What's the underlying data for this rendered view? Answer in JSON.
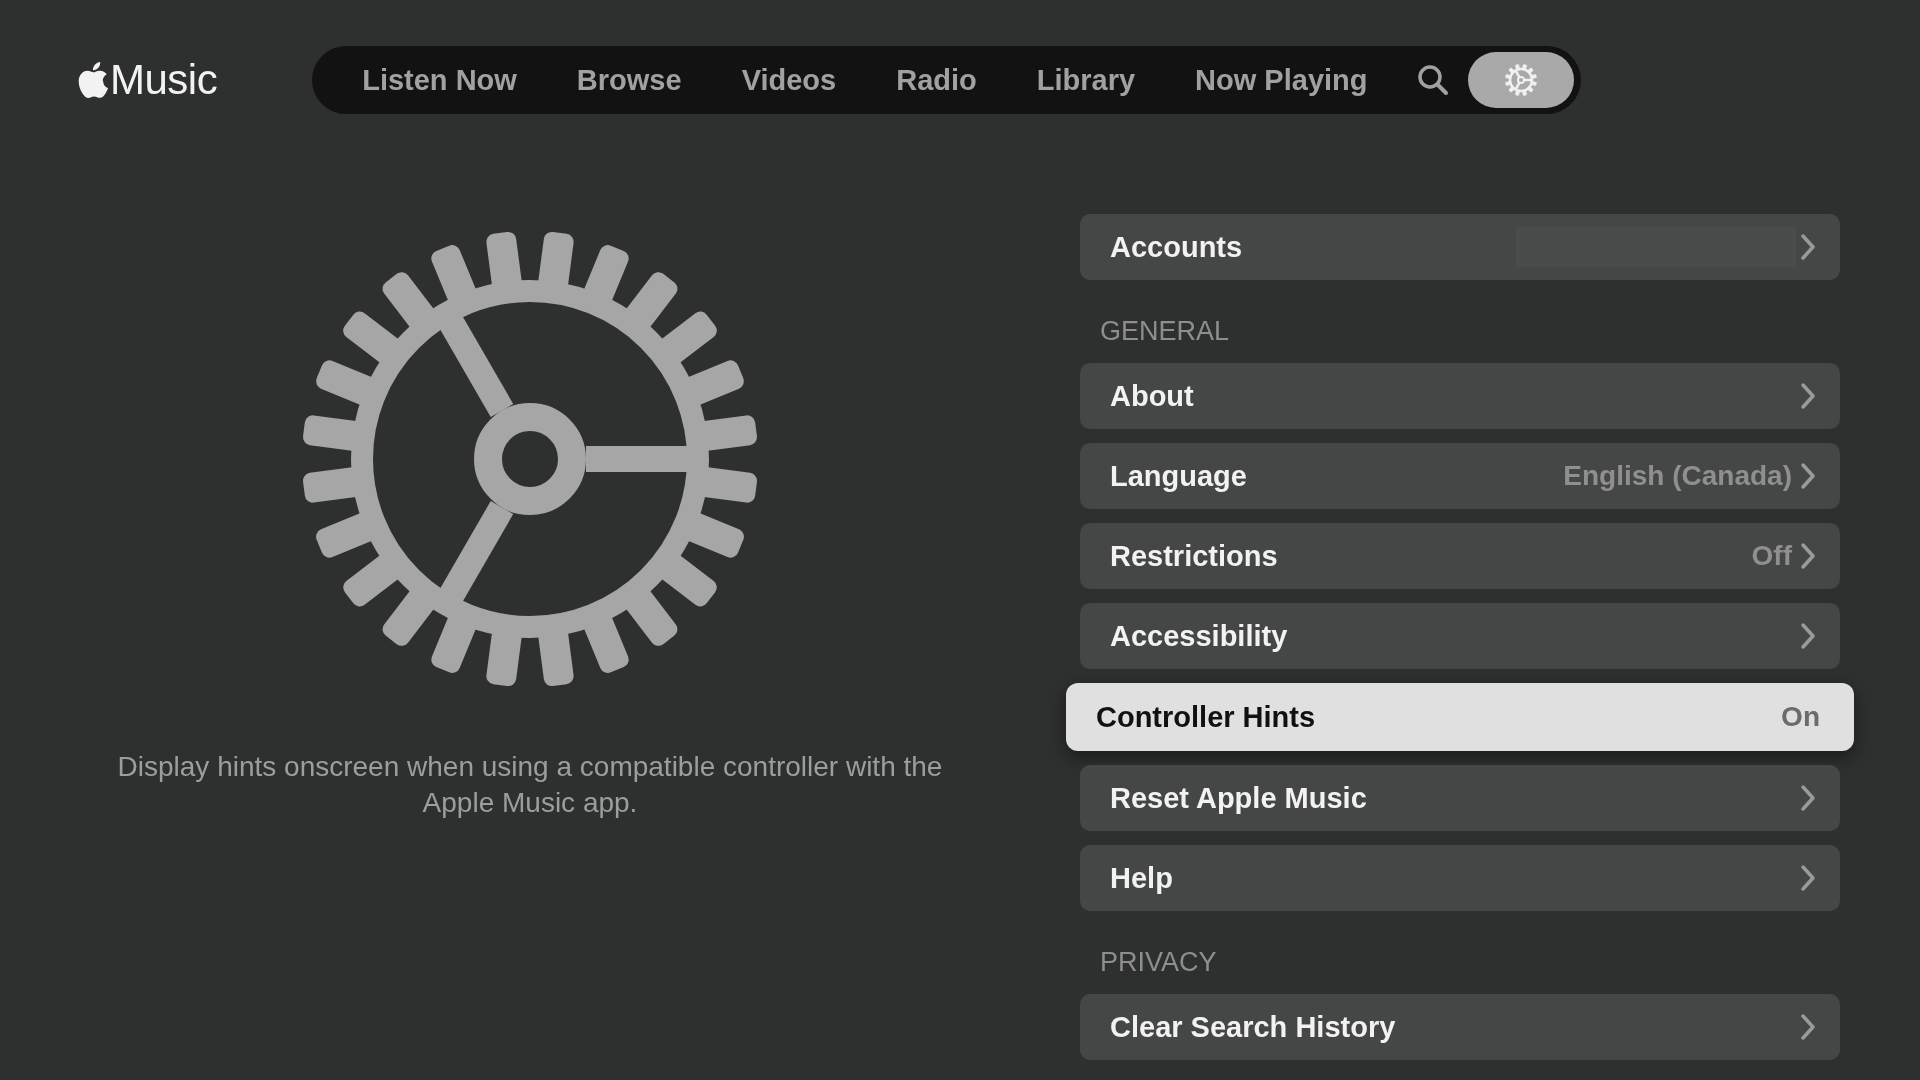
{
  "brand": {
    "name": "Music"
  },
  "nav": {
    "tabs": [
      {
        "label": "Listen Now",
        "selected": false
      },
      {
        "label": "Browse",
        "selected": false
      },
      {
        "label": "Videos",
        "selected": false
      },
      {
        "label": "Radio",
        "selected": false
      },
      {
        "label": "Library",
        "selected": false
      },
      {
        "label": "Now Playing",
        "selected": false
      }
    ],
    "search_selected": false,
    "settings_selected": true
  },
  "description": "Display hints onscreen when using a compatible controller with the Apple Music app.",
  "sections": [
    {
      "rows": [
        {
          "label": "Accounts",
          "redacted": true,
          "chevron": true,
          "focused": false
        }
      ]
    },
    {
      "heading": "GENERAL",
      "rows": [
        {
          "label": "About",
          "chevron": true,
          "focused": false
        },
        {
          "label": "Language",
          "value": "English (Canada)",
          "chevron": true,
          "focused": false
        },
        {
          "label": "Restrictions",
          "value": "Off",
          "chevron": true,
          "focused": false
        },
        {
          "label": "Accessibility",
          "chevron": true,
          "focused": false
        },
        {
          "label": "Controller Hints",
          "value": "On",
          "chevron": false,
          "focused": true
        },
        {
          "label": "Reset Apple Music",
          "chevron": true,
          "focused": false
        },
        {
          "label": "Help",
          "chevron": true,
          "focused": false
        }
      ]
    },
    {
      "heading": "PRIVACY",
      "rows": [
        {
          "label": "Clear Search History",
          "chevron": true,
          "focused": false
        }
      ]
    }
  ]
}
